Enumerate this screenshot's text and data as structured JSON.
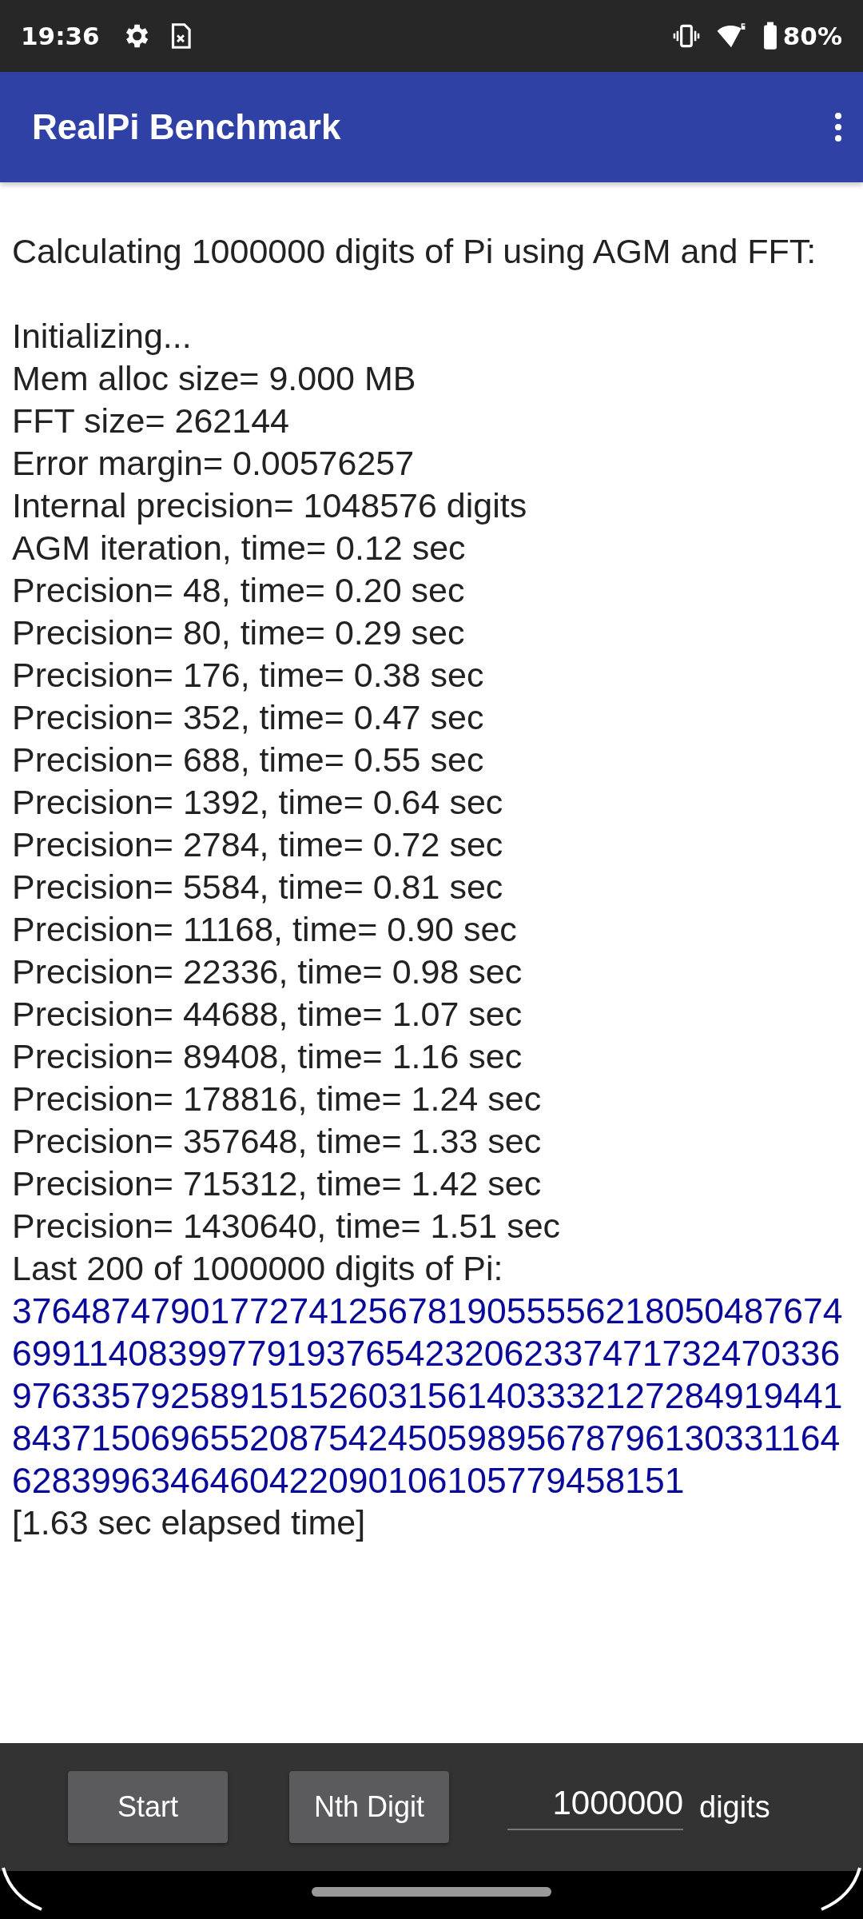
{
  "status_bar": {
    "time": "19:36",
    "battery": "80%"
  },
  "app_bar": {
    "title": "RealPi Benchmark"
  },
  "output": {
    "heading": "Calculating 1000000 digits of Pi using AGM and FFT:",
    "lines": [
      "Initializing...",
      "Mem alloc size= 9.000 MB",
      "FFT size= 262144",
      "Error margin= 0.00576257",
      "Internal precision= 1048576 digits",
      "AGM iteration, time= 0.12 sec",
      "Precision= 48, time= 0.20 sec",
      "Precision= 80, time= 0.29 sec",
      "Precision= 176, time= 0.38 sec",
      "Precision= 352, time= 0.47 sec",
      "Precision= 688, time= 0.55 sec",
      "Precision= 1392, time= 0.64 sec",
      "Precision= 2784, time= 0.72 sec",
      "Precision= 5584, time= 0.81 sec",
      "Precision= 11168, time= 0.90 sec",
      "Precision= 22336, time= 0.98 sec",
      "Precision= 44688, time= 1.07 sec",
      "Precision= 89408, time= 1.16 sec",
      "Precision= 178816, time= 1.24 sec",
      "Precision= 357648, time= 1.33 sec",
      "Precision= 715312, time= 1.42 sec",
      "Precision= 1430640, time= 1.51 sec",
      "Last 200 of 1000000 digits of Pi:"
    ],
    "digits": [
      "376487479017727412567819055556218050487674",
      "699114083997791937654232062337471732470336",
      "976335792589151526031561403332127284919441",
      "843715069655208754245059895678796130331164",
      "6283996346460422090106105779458151"
    ],
    "elapsed": "[1.63 sec elapsed time]"
  },
  "bottom_bar": {
    "buttons": [
      "Start",
      "Nth Digit"
    ],
    "digits_value": "1000000",
    "digits_label": "digits"
  }
}
